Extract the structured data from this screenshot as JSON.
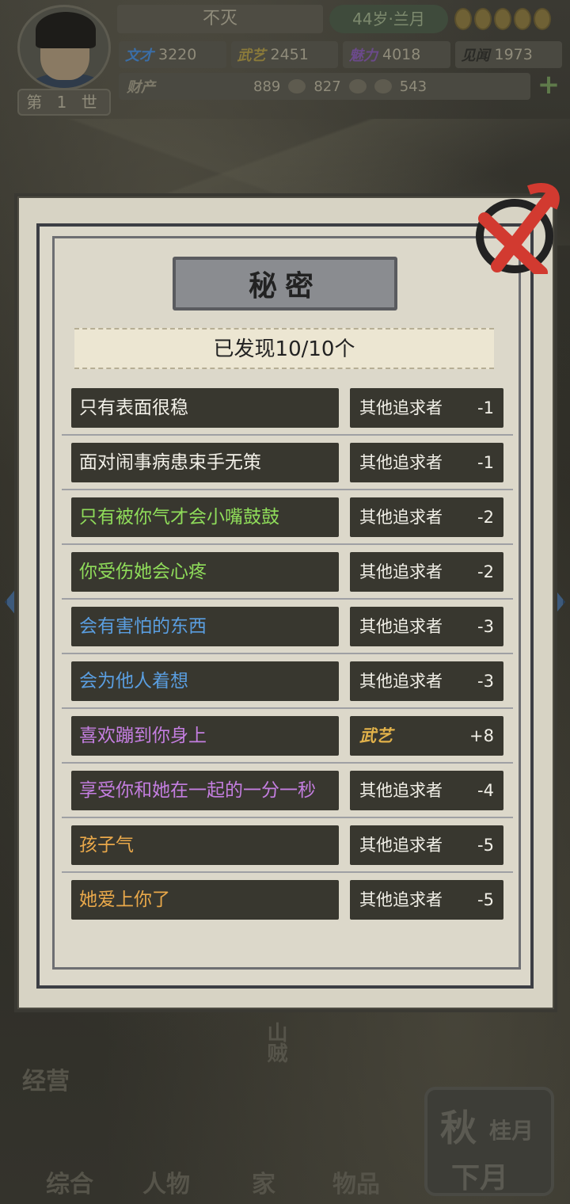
{
  "hud": {
    "name": "不灭",
    "age": "44岁·兰月",
    "generation": "第 1 世",
    "stats": [
      {
        "name": "文才",
        "value": "3220",
        "color": "#3a6ea8"
      },
      {
        "name": "武艺",
        "value": "2451",
        "color": "#8a7a3a"
      },
      {
        "name": "魅力",
        "value": "4018",
        "color": "#6b4a8a"
      },
      {
        "name": "见闻",
        "value": "1973",
        "color": "#2a2a26"
      }
    ],
    "wealth_label": "财产",
    "wealth": [
      "889",
      "827",
      "543"
    ],
    "plus": "+"
  },
  "modal": {
    "title": "秘密",
    "discovered": "已发现10/10个"
  },
  "secrets": [
    {
      "text": "只有表面很稳",
      "color": "#f2f0e8",
      "target": "其他追求者",
      "value": "-1",
      "skill": false
    },
    {
      "text": "面对闹事病患束手无策",
      "color": "#f2f0e8",
      "target": "其他追求者",
      "value": "-1",
      "skill": false
    },
    {
      "text": "只有被你气才会小嘴鼓鼓",
      "color": "#8fdc5a",
      "target": "其他追求者",
      "value": "-2",
      "skill": false
    },
    {
      "text": "你受伤她会心疼",
      "color": "#8fdc5a",
      "target": "其他追求者",
      "value": "-2",
      "skill": false
    },
    {
      "text": "会有害怕的东西",
      "color": "#5a9ee0",
      "target": "其他追求者",
      "value": "-3",
      "skill": false
    },
    {
      "text": "会为他人着想",
      "color": "#5a9ee0",
      "target": "其他追求者",
      "value": "-3",
      "skill": false
    },
    {
      "text": "喜欢蹦到你身上",
      "color": "#c47ee0",
      "target": "武艺",
      "value": "+8",
      "skill": true
    },
    {
      "text": "享受你和她在一起的一分一秒",
      "color": "#c47ee0",
      "target": "其他追求者",
      "value": "-4",
      "skill": false
    },
    {
      "text": "孩子气",
      "color": "#e9a84a",
      "target": "其他追求者",
      "value": "-5",
      "skill": false
    },
    {
      "text": "她爱上你了",
      "color": "#e9a84a",
      "target": "其他追求者",
      "value": "-5",
      "skill": false
    }
  ],
  "bottom_menu": {
    "business": "经营",
    "overview": "综合",
    "characters": "人物",
    "family": "家",
    "items": "物品",
    "mountain": "山贼",
    "season": "秋",
    "month": "桂月",
    "next": "下月"
  },
  "icons": {
    "close": "close-x-icon",
    "left_arrow": "chevron-left-icon",
    "right_arrow": "chevron-right-icon"
  }
}
